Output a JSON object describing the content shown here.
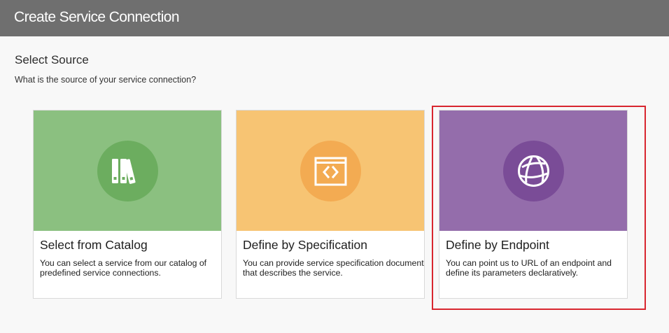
{
  "header": {
    "title": "Create Service Connection"
  },
  "main": {
    "section_title": "Select Source",
    "section_subtitle": "What is the source of your service connection?"
  },
  "cards": [
    {
      "title": "Select from Catalog",
      "description": "You can select a service from our catalog of predefined service connections.",
      "icon": "books-icon",
      "color": "#8bc080",
      "icon_bg": "#6cad5f"
    },
    {
      "title": "Define by Specification",
      "description": "You can provide service specification document that describes the service.",
      "icon": "code-window-icon",
      "color": "#f7c473",
      "icon_bg": "#f3ab52"
    },
    {
      "title": "Define by Endpoint",
      "description": "You can point us to URL of an endpoint and define its parameters declaratively.",
      "icon": "globe-icon",
      "color": "#946dab",
      "icon_bg": "#7a4c97"
    }
  ],
  "highlight_color": "#d8262f"
}
